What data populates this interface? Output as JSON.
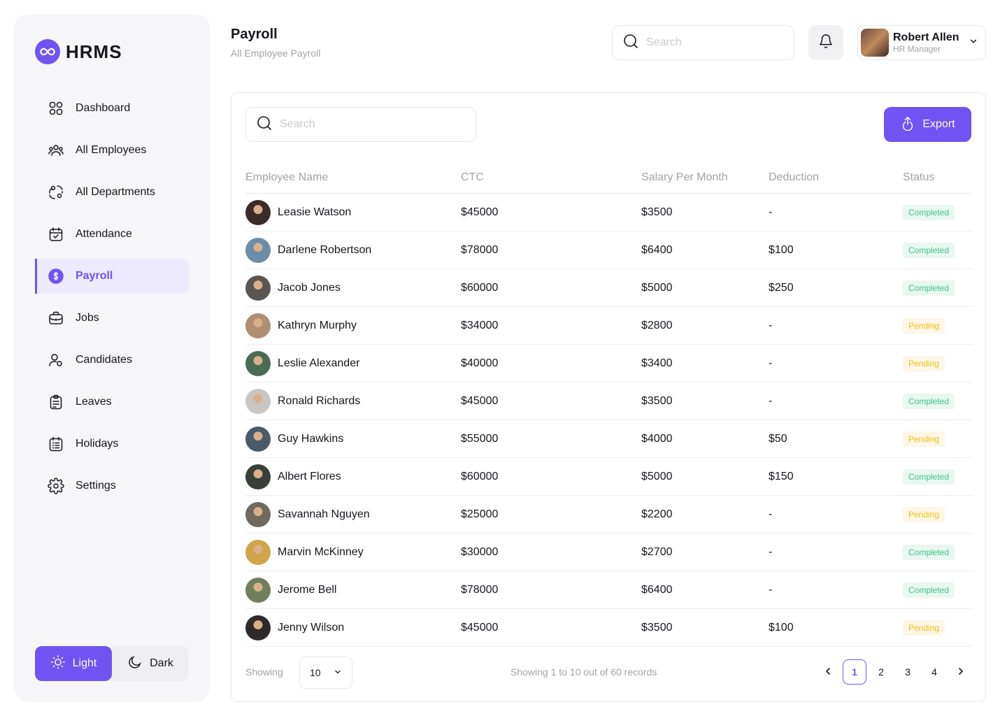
{
  "app": {
    "logo_text": "HRMS",
    "accent": "#7152F3"
  },
  "sidebar": {
    "items": [
      {
        "label": "Dashboard",
        "icon": "dashboard-icon",
        "active": false
      },
      {
        "label": "All Employees",
        "icon": "users-icon",
        "active": false
      },
      {
        "label": "All Departments",
        "icon": "departments-icon",
        "active": false
      },
      {
        "label": "Attendance",
        "icon": "calendar-check-icon",
        "active": false
      },
      {
        "label": "Payroll",
        "icon": "dollar-circle-icon",
        "active": true
      },
      {
        "label": "Jobs",
        "icon": "briefcase-icon",
        "active": false
      },
      {
        "label": "Candidates",
        "icon": "candidates-icon",
        "active": false
      },
      {
        "label": "Leaves",
        "icon": "clipboard-icon",
        "active": false
      },
      {
        "label": "Holidays",
        "icon": "holiday-list-icon",
        "active": false
      },
      {
        "label": "Settings",
        "icon": "gear-icon",
        "active": false
      }
    ],
    "theme": {
      "light_label": "Light",
      "dark_label": "Dark",
      "selected": "Light"
    }
  },
  "header": {
    "title": "Payroll",
    "subtitle": "All Employee Payroll",
    "search_placeholder": "Search",
    "user": {
      "name": "Robert Allen",
      "role": "HR Manager"
    }
  },
  "table": {
    "search_placeholder": "Search",
    "export_label": "Export",
    "columns": [
      "Employee Name",
      "CTC",
      "Salary Per Month",
      "Deduction",
      "Status"
    ],
    "rows": [
      {
        "name": "Leasie Watson",
        "ctc": "$45000",
        "salary": "$3500",
        "deduction": "-",
        "status": "Completed"
      },
      {
        "name": "Darlene Robertson",
        "ctc": "$78000",
        "salary": "$6400",
        "deduction": "$100",
        "status": "Completed"
      },
      {
        "name": "Jacob Jones",
        "ctc": "$60000",
        "salary": "$5000",
        "deduction": "$250",
        "status": "Completed"
      },
      {
        "name": "Kathryn Murphy",
        "ctc": "$34000",
        "salary": "$2800",
        "deduction": "-",
        "status": "Pending"
      },
      {
        "name": "Leslie Alexander",
        "ctc": "$40000",
        "salary": "$3400",
        "deduction": "-",
        "status": "Pending"
      },
      {
        "name": "Ronald Richards",
        "ctc": "$45000",
        "salary": "$3500",
        "deduction": "-",
        "status": "Completed"
      },
      {
        "name": "Guy Hawkins",
        "ctc": "$55000",
        "salary": "$4000",
        "deduction": "$50",
        "status": "Pending"
      },
      {
        "name": "Albert Flores",
        "ctc": "$60000",
        "salary": "$5000",
        "deduction": "$150",
        "status": "Completed"
      },
      {
        "name": "Savannah Nguyen",
        "ctc": "$25000",
        "salary": "$2200",
        "deduction": "-",
        "status": "Pending"
      },
      {
        "name": "Marvin McKinney",
        "ctc": "$30000",
        "salary": "$2700",
        "deduction": "-",
        "status": "Completed"
      },
      {
        "name": "Jerome Bell",
        "ctc": "$78000",
        "salary": "$6400",
        "deduction": "-",
        "status": "Completed"
      },
      {
        "name": "Jenny Wilson",
        "ctc": "$45000",
        "salary": "$3500",
        "deduction": "$100",
        "status": "Pending"
      }
    ],
    "footer": {
      "showing_label": "Showing",
      "page_size": "10",
      "records_text": "Showing 1 to 10 out of 60 records",
      "pages": [
        "1",
        "2",
        "3",
        "4"
      ],
      "current_page": "1"
    }
  },
  "colors": {
    "completed_bg": "#E8F7EF",
    "completed_fg": "#3FC28A",
    "pending_bg": "#FEF6E6",
    "pending_fg": "#EFBE12"
  }
}
